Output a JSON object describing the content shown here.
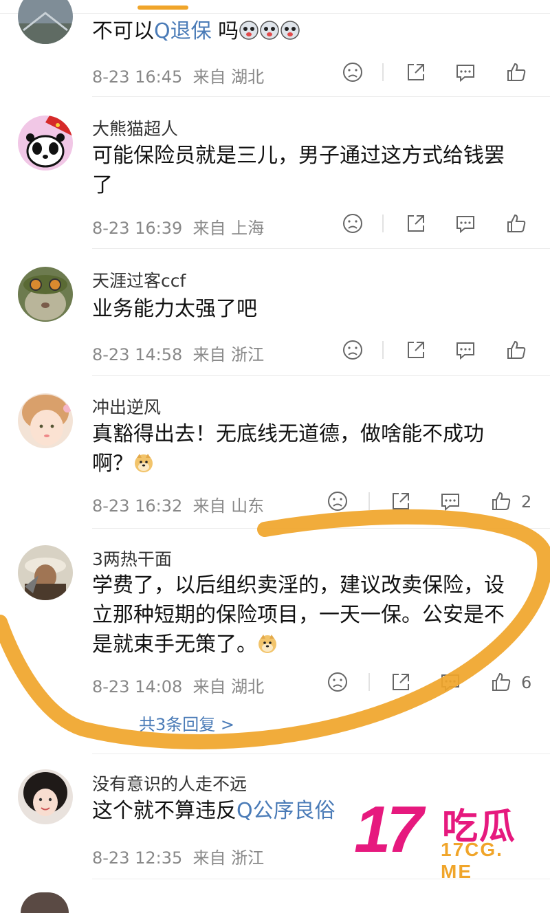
{
  "comments": [
    {
      "username": "",
      "text_parts": [
        {
          "kind": "text",
          "value": "不可以"
        },
        {
          "kind": "link",
          "value": "Q退保"
        },
        {
          "kind": "text",
          "value": " 吗"
        },
        {
          "kind": "emoji",
          "value": "husky-emoji"
        },
        {
          "kind": "emoji",
          "value": "husky-emoji"
        },
        {
          "kind": "emoji",
          "value": "husky-emoji"
        }
      ],
      "time": "8-23 16:45",
      "location": "来自 湖北",
      "like_count": ""
    },
    {
      "username": "大熊猫超人",
      "text_parts": [
        {
          "kind": "text",
          "value": "可能保险员就是三儿，男子通过这方式给钱罢了"
        }
      ],
      "time": "8-23 16:39",
      "location": "来自 上海",
      "like_count": ""
    },
    {
      "username": "天涯过客ccf",
      "text_parts": [
        {
          "kind": "text",
          "value": "业务能力太强了吧"
        }
      ],
      "time": "8-23 14:58",
      "location": "来自 浙江",
      "like_count": ""
    },
    {
      "username": "冲出逆风",
      "text_parts": [
        {
          "kind": "text",
          "value": "真豁得出去！无底线无道德，做啥能不成功啊？"
        },
        {
          "kind": "emoji",
          "value": "doge-emoji"
        }
      ],
      "time": "8-23 16:32",
      "location": "来自 山东",
      "like_count": "2"
    },
    {
      "username": "3两热干面",
      "text_parts": [
        {
          "kind": "text",
          "value": "学费了，以后组织卖淫的，建议改卖保险，设立那种短期的保险项目，一天一保。公安是不是就束手无策了。"
        },
        {
          "kind": "emoji",
          "value": "doge-emoji"
        }
      ],
      "time": "8-23 14:08",
      "location": "来自 湖北",
      "like_count": "6",
      "replies_label": "共3条回复 >"
    },
    {
      "username": "没有意识的人走不远",
      "text_parts": [
        {
          "kind": "text",
          "value": "这个就不算违反"
        },
        {
          "kind": "link",
          "value": "Q公序良俗"
        }
      ],
      "time": "8-23 12:35",
      "location": "来自 浙江",
      "like_count": ""
    }
  ],
  "watermark": {
    "number": "17",
    "chinese": "吃瓜",
    "url": "17CG. ME",
    "pink": "#e6197e",
    "orange": "#f0a52a"
  },
  "colors": {
    "accent": "#f0a52a",
    "link": "#4a7bb7",
    "meta_text": "#888888"
  },
  "icons": [
    "dislike-icon",
    "share-icon",
    "comment-icon",
    "like-icon"
  ]
}
